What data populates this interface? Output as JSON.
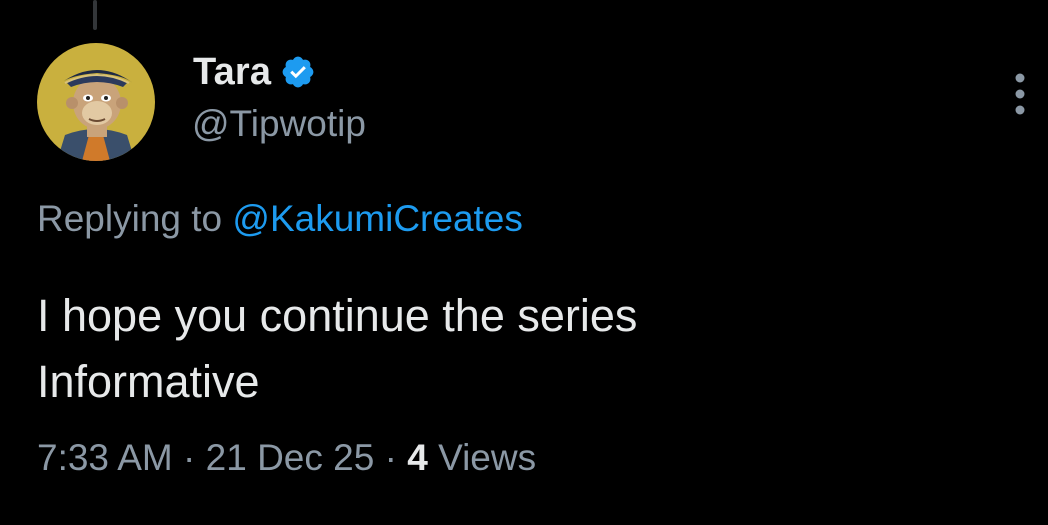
{
  "tweet": {
    "author": {
      "display_name": "Tara",
      "handle": "@Tipwotip",
      "verified": true,
      "avatar_icon": "bored-ape-pirate-avatar"
    },
    "reply_context": {
      "prefix": "Replying to",
      "mention": "@KakumiCreates"
    },
    "text_lines": [
      "I hope you continue the series",
      "Informative"
    ],
    "meta": {
      "time": "7:33 AM",
      "separator": "·",
      "date": "21 Dec 25",
      "views_count": "4",
      "views_label": "Views"
    },
    "more_icon": "more-vertical-icon"
  },
  "colors": {
    "background": "#000000",
    "primary_text": "#e7e9ea",
    "secondary_text": "#8b98a5",
    "link": "#1d9bf0",
    "verified": "#1d9bf0",
    "thread_line": "#333639"
  }
}
